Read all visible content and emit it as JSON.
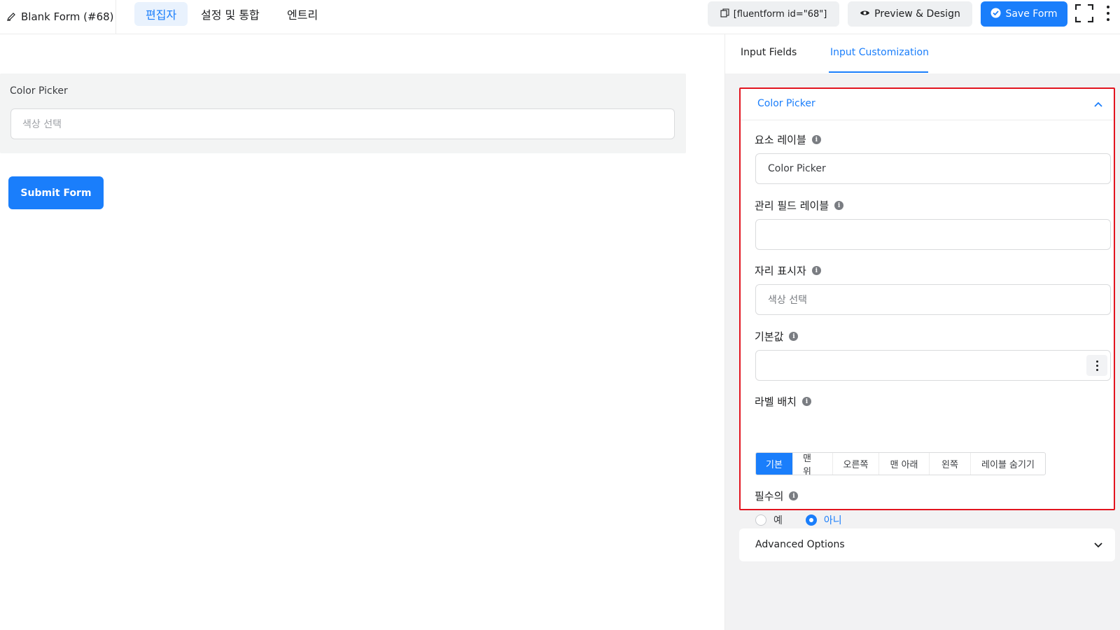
{
  "header": {
    "form_title": "Blank Form (#68)",
    "tabs": [
      {
        "label": "편집자",
        "active": true
      },
      {
        "label": "설정 및 통합",
        "active": false
      },
      {
        "label": "엔트리",
        "active": false
      }
    ],
    "shortcode_label": "[fluentform id=\"68\"]",
    "preview_label": "Preview & Design",
    "save_label": "Save Form"
  },
  "canvas": {
    "field_label": "Color Picker",
    "field_placeholder": "색상 선택",
    "submit_label": "Submit Form"
  },
  "panel": {
    "tabs": [
      {
        "label": "Input Fields",
        "active": false
      },
      {
        "label": "Input Customization",
        "active": true
      }
    ],
    "section_title": "Color Picker",
    "fields": {
      "element_label": {
        "label": "요소 레이블",
        "value": "Color Picker"
      },
      "admin_label": {
        "label": "관리 필드 레이블",
        "value": ""
      },
      "placeholder": {
        "label": "자리 표시자",
        "value": "색상 선택"
      },
      "default_value": {
        "label": "기본값",
        "value": ""
      },
      "label_placement": {
        "label": "라벨 배치",
        "options": [
          "기본",
          "맨 위",
          "오른쪽",
          "맨 아래",
          "왼쪽",
          "레이블 숨기기"
        ],
        "selected": "기본"
      },
      "required": {
        "label": "필수의",
        "options": [
          "예",
          "아니"
        ],
        "selected": "아니"
      }
    },
    "advanced_title": "Advanced Options"
  },
  "colors": {
    "primary": "#1a7efb",
    "highlight_border": "#e2141f",
    "panel_bg": "#f2f2f3",
    "canvas_field_bg": "#f3f4f4"
  },
  "icons": [
    "pen-icon",
    "copy-icon",
    "eye-icon",
    "check-circle-icon",
    "fullscreen-icon",
    "kebab-icon",
    "info-icon",
    "chevron-up-icon",
    "chevron-down-icon"
  ]
}
